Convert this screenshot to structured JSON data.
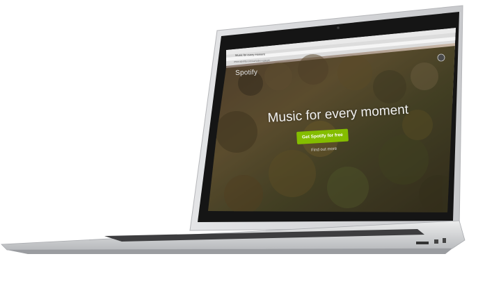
{
  "browser": {
    "tab_title": "Music for every moment",
    "url": "www.spotify.com/es/video-splash/"
  },
  "page": {
    "logo_text": "Spotify",
    "headline": "Music for every moment",
    "cta_label": "Get Spotify for free",
    "secondary_link": "Find out more"
  },
  "colors": {
    "cta": "#84bd00",
    "laptop_body": "#d9dadc",
    "bezel": "#1a1a1a"
  }
}
